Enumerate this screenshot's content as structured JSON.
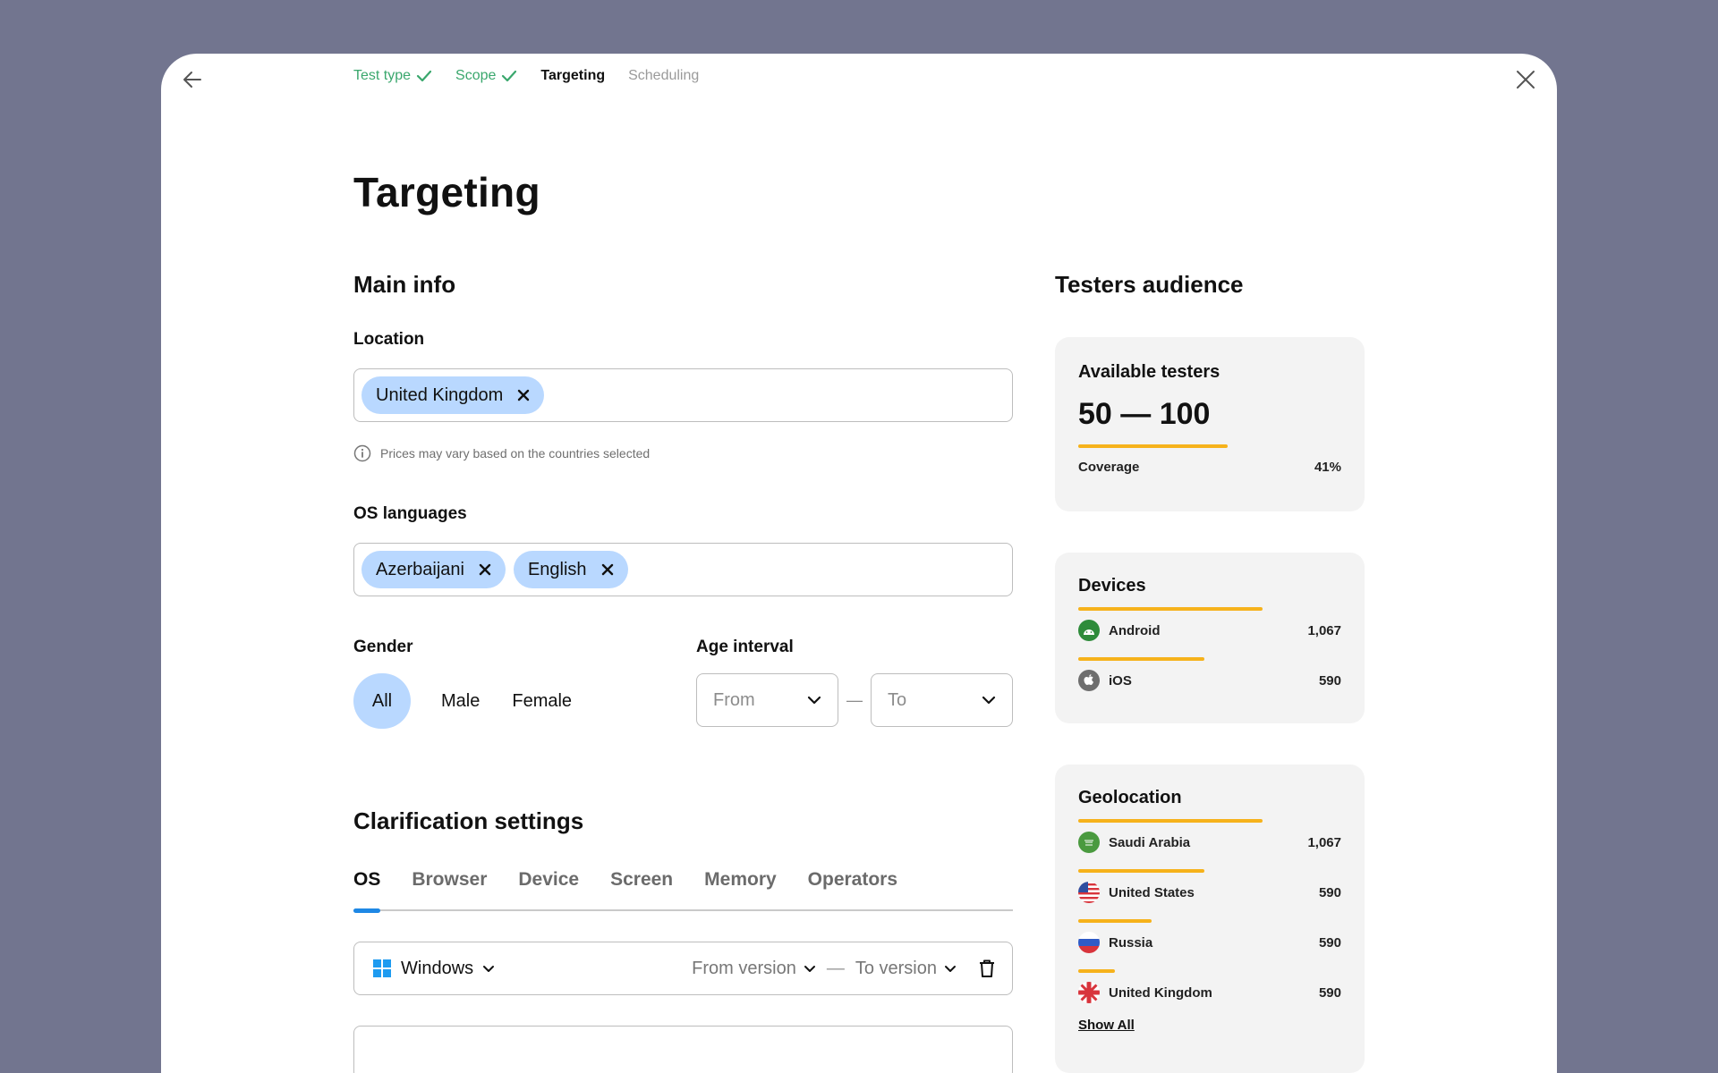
{
  "stepper": {
    "steps": [
      {
        "label": "Test type",
        "state": "done"
      },
      {
        "label": "Scope",
        "state": "done"
      },
      {
        "label": "Targeting",
        "state": "active"
      },
      {
        "label": "Scheduling",
        "state": "pending"
      }
    ]
  },
  "page": {
    "title": "Targeting"
  },
  "main_info": {
    "title": "Main info",
    "location": {
      "label": "Location",
      "chips": [
        "United Kingdom"
      ],
      "hint": "Prices may vary based on the countries selected"
    },
    "os_languages": {
      "label": "OS languages",
      "chips": [
        "Azerbaijani",
        "English"
      ]
    },
    "gender": {
      "label": "Gender",
      "options": [
        "All",
        "Male",
        "Female"
      ],
      "selected": "All"
    },
    "age": {
      "label": "Age interval",
      "from_placeholder": "From",
      "separator": "—",
      "to_placeholder": "To"
    }
  },
  "clarification": {
    "title": "Clarification settings",
    "tabs": [
      "OS",
      "Browser",
      "Device",
      "Screen",
      "Memory",
      "Operators"
    ],
    "active_tab": "OS",
    "os_row": {
      "os": "Windows",
      "from_version": "From version",
      "separator": "—",
      "to_version": "To version"
    }
  },
  "audience": {
    "title": "Testers audience",
    "available": {
      "title": "Available testers",
      "range": "50 — 100",
      "coverage_label": "Coverage",
      "coverage_value": "41%",
      "coverage_fraction": 0.41
    },
    "devices": {
      "title": "Devices",
      "items": [
        {
          "name": "Android",
          "count": "1,067",
          "icon": "android-icon",
          "share": 1.0
        },
        {
          "name": "iOS",
          "count": "590",
          "icon": "apple-icon",
          "share": 0.69
        }
      ]
    },
    "geolocation": {
      "title": "Geolocation",
      "items": [
        {
          "name": "Saudi Arabia",
          "count": "1,067",
          "icon": "saudi-arabia-flag-icon",
          "share": 1.0
        },
        {
          "name": "United States",
          "count": "590",
          "icon": "united-states-flag-icon",
          "share": 0.69
        },
        {
          "name": "Russia",
          "count": "590",
          "icon": "russia-flag-icon",
          "share": 0.4
        },
        {
          "name": "United Kingdom",
          "count": "590",
          "icon": "united-kingdom-flag-icon",
          "share": 0.2
        }
      ],
      "show_all": "Show All"
    }
  },
  "colors": {
    "accent_blue": "#b9d8ff",
    "tab_indicator": "#1e88e5",
    "done_green": "#3aa76d",
    "bar_orange": "#f6b21b",
    "backdrop": "#72758f"
  }
}
